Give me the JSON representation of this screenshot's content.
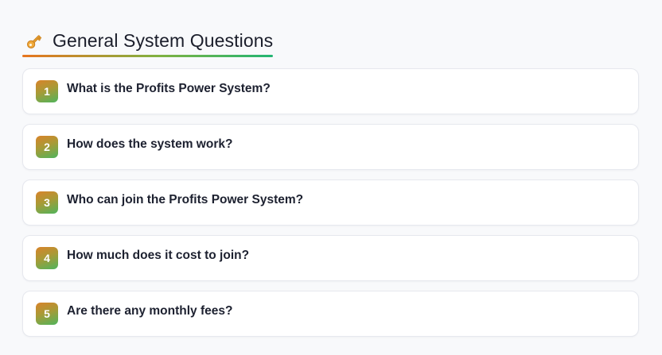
{
  "section": {
    "icon": "key-icon",
    "title": "General System Questions",
    "underline_colors": [
      "#e8751f",
      "#7fb241",
      "#22b573"
    ]
  },
  "faq": [
    {
      "number": "1",
      "question": "What is the Profits Power System?"
    },
    {
      "number": "2",
      "question": "How does the system work?"
    },
    {
      "number": "3",
      "question": "Who can join the Profits Power System?"
    },
    {
      "number": "4",
      "question": "How much does it cost to join?"
    },
    {
      "number": "5",
      "question": "Are there any monthly fees?"
    }
  ]
}
